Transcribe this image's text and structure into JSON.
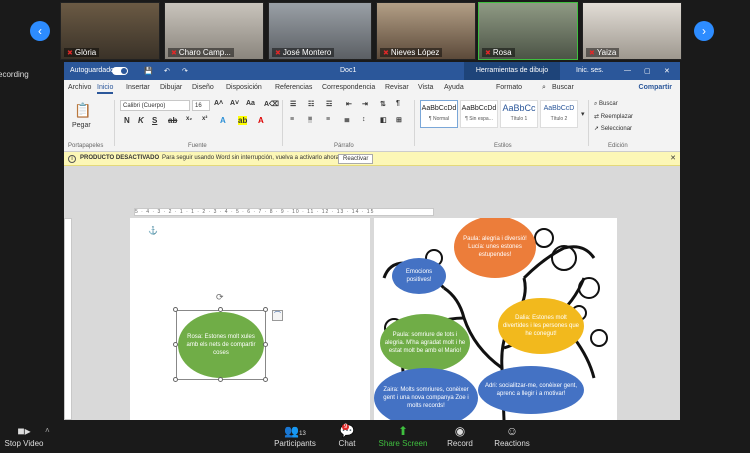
{
  "gallery": {
    "participants": [
      {
        "name": "Glòria"
      },
      {
        "name": "Charo Camp..."
      },
      {
        "name": "José Montero"
      },
      {
        "name": "Nieves López"
      },
      {
        "name": "Rosa"
      },
      {
        "name": "Yaiza"
      }
    ],
    "recording_label": "ecording"
  },
  "word": {
    "titlebar": {
      "autosave": "Autoguardado",
      "doc_name": "Doc1",
      "drawing_tools": "Herramientas de dibujo",
      "signin": "Inic. ses."
    },
    "menu": [
      "Archivo",
      "Inicio",
      "Insertar",
      "Dibujar",
      "Diseño",
      "Disposición",
      "Referencias",
      "Correspondencia",
      "Revisar",
      "Vista",
      "Ayuda",
      "Formato"
    ],
    "search": "Buscar",
    "share": "Compartir",
    "ribbon": {
      "paste": "Pegar",
      "clipboard_label": "Portapapeles",
      "font_name": "Calibri (Cuerpo)",
      "font_size": "16",
      "font_label": "Fuente",
      "paragraph_label": "Párrafo",
      "styles_label": "Estilos",
      "styles": [
        {
          "preview": "AaBbCcDd",
          "label": "¶ Normal"
        },
        {
          "preview": "AaBbCcDd",
          "label": "¶ Sin espa..."
        },
        {
          "preview": "AaBbCc",
          "label": "Título 1"
        },
        {
          "preview": "AaBbCcD",
          "label": "Título 2"
        }
      ],
      "edit_label": "Edición",
      "edit_buttons": [
        "Buscar",
        "Reemplazar",
        "Seleccionar"
      ]
    },
    "infobar": {
      "title": "PRODUCTO DESACTIVADO",
      "message": "Para seguir usando Word sin interrupción, vuelva a activarlo ahora.",
      "button": "Reactivar"
    },
    "ruler_text": "5 · 4 · 3 · 2 · 1 · 1 · 2 · 3 · 4 · 5 · 6 · 7 · 8 · 9 · 10 · 11 · 12 · 13 · 14 · 15",
    "page1_bubble": "Rosa: Estones molt xules amb els nets de compartir coses",
    "page2_bubbles": [
      {
        "text": "Paula: alegria i diversió! Lucía: unes estones estupendes!",
        "color": "#ec7d3a"
      },
      {
        "text": "Emocions positives!",
        "color": "#4472c4"
      },
      {
        "text": "Dalia: Estones molt divertides i les persones que he conegut!",
        "color": "#f2b91d"
      },
      {
        "text": "Paula: somriure de tots i alegria. M'ha agradat molt i he estat molt be amb el Mario!",
        "color": "#70ad47"
      },
      {
        "text": "Zaira: Molts somriures, conèixer gent i una nova companya Zoe i molts records!",
        "color": "#4472c4"
      },
      {
        "text": "Adri: socialitzar-me, conèixer gent, aprenc a llegir i a motivar!",
        "color": "#4472c4"
      }
    ]
  },
  "toolbar": {
    "stop_video": "Stop Video",
    "participants": "Participants",
    "participants_count": "13",
    "chat": "Chat",
    "chat_badge": "9",
    "share_screen": "Share Screen",
    "record": "Record",
    "reactions": "Reactions"
  }
}
